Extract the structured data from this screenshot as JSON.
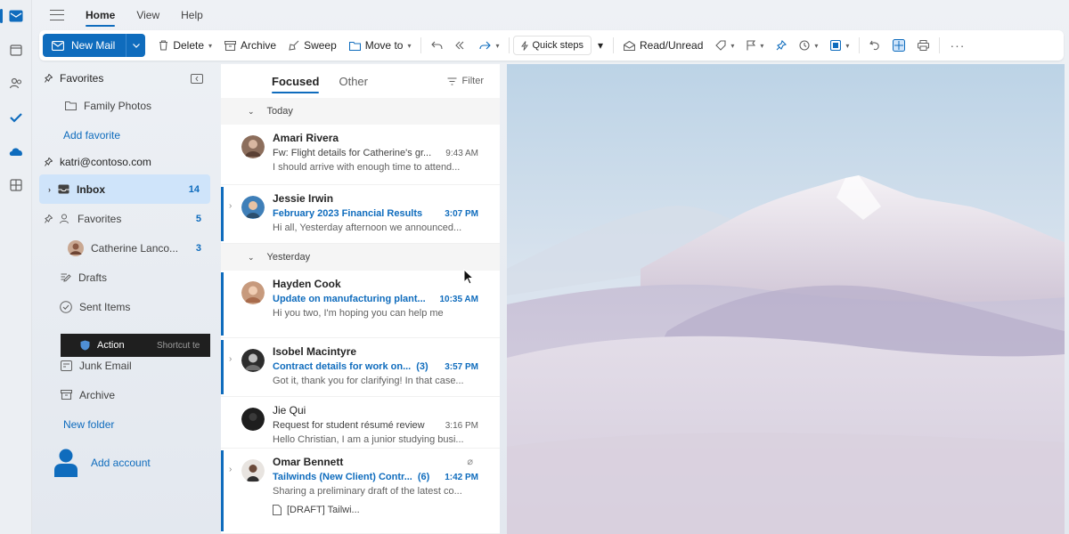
{
  "topbar": {
    "tabs": [
      "Home",
      "View",
      "Help"
    ]
  },
  "ribbon": {
    "new_mail": "New Mail",
    "delete": "Delete",
    "archive": "Archive",
    "sweep": "Sweep",
    "move_to": "Move to",
    "quick_steps": "Quick steps",
    "read_unread": "Read/Unread"
  },
  "folders": {
    "favorites_header": "Favorites",
    "family_photos": "Family Photos",
    "add_favorite": "Add favorite",
    "account": "katri@contoso.com",
    "inbox": {
      "label": "Inbox",
      "count": "14"
    },
    "favorites": {
      "label": "Favorites",
      "count": "5"
    },
    "catherine": {
      "label": "Catherine Lanco...",
      "count": "3"
    },
    "drafts": "Drafts",
    "sent": "Sent Items",
    "action": {
      "label": "Action",
      "shortcut": "Shortcut te"
    },
    "junk": "Junk Email",
    "archive": "Archive",
    "new_folder": "New folder",
    "add_account": "Add account"
  },
  "list": {
    "tab_focused": "Focused",
    "tab_other": "Other",
    "filter": "Filter",
    "group_today": "Today",
    "group_yesterday": "Yesterday",
    "messages": [
      {
        "from": "Amari Rivera",
        "subject": "Fw: Flight details for Catherine's gr...",
        "time": "9:43 AM",
        "preview": "I should arrive with enough time to attend...",
        "count": ""
      },
      {
        "from": "Jessie Irwin",
        "subject": "February 2023 Financial Results",
        "time": "3:07 PM",
        "preview": "Hi all, Yesterday afternoon we announced...",
        "count": ""
      },
      {
        "from": "Hayden Cook",
        "subject": "Update on manufacturing plant...",
        "time": "10:35 AM",
        "preview": "Hi you two, I'm hoping you can help me",
        "count": ""
      },
      {
        "from": "Isobel Macintyre",
        "subject": "Contract details for work on...",
        "time": "3:57 PM",
        "preview": "Got it, thank you for clarifying! In that case...",
        "count": "(3)"
      },
      {
        "from": "Jie Qui",
        "subject": "Request for student résumé review",
        "time": "3:16 PM",
        "preview": "Hello Christian, I am a junior studying busi...",
        "count": ""
      },
      {
        "from": "Omar Bennett",
        "subject": "Tailwinds (New Client) Contr...",
        "time": "1:42 PM",
        "preview": "Sharing a preliminary draft of the latest co...",
        "count": "(6)"
      }
    ],
    "draft_chip": "[DRAFT] Tailwi..."
  },
  "colors": {
    "accent": "#0f6cbd",
    "selected_folder": "#cfe4fa"
  }
}
